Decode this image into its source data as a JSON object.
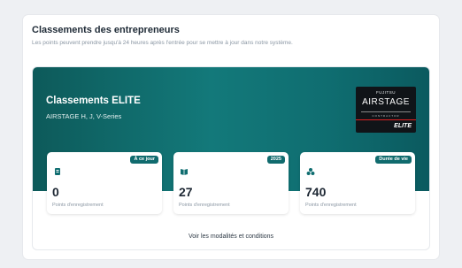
{
  "header": {
    "title": "Classements des entrepreneurs",
    "subtitle": "Les points peuvent prendre jusqu'à 24 heures après l'entrée pour se mettre à jour dans notre système."
  },
  "banner": {
    "title": "Classements ELITE",
    "subtitle": "AIRSTAGE H, J, V-Series",
    "logo": {
      "brand": "FUJITSU",
      "product": "AIRSTAGE",
      "program": "CONTRACTOR",
      "tier": "ELITE"
    }
  },
  "stats": [
    {
      "badge": "À ce jour",
      "value": "0",
      "label": "Points d'enregistrement",
      "icon": "register-icon"
    },
    {
      "badge": "2025",
      "value": "27",
      "label": "Points d'enregistrement",
      "icon": "book-icon"
    },
    {
      "badge": "Durée de vie",
      "value": "740",
      "label": "Points d'enregistrement",
      "icon": "cluster-icon"
    }
  ],
  "footer": {
    "link": "Voir les modalités et conditions"
  },
  "colors": {
    "accent": "#106b6e",
    "banner": "#13797a",
    "text": "#1d2733"
  }
}
